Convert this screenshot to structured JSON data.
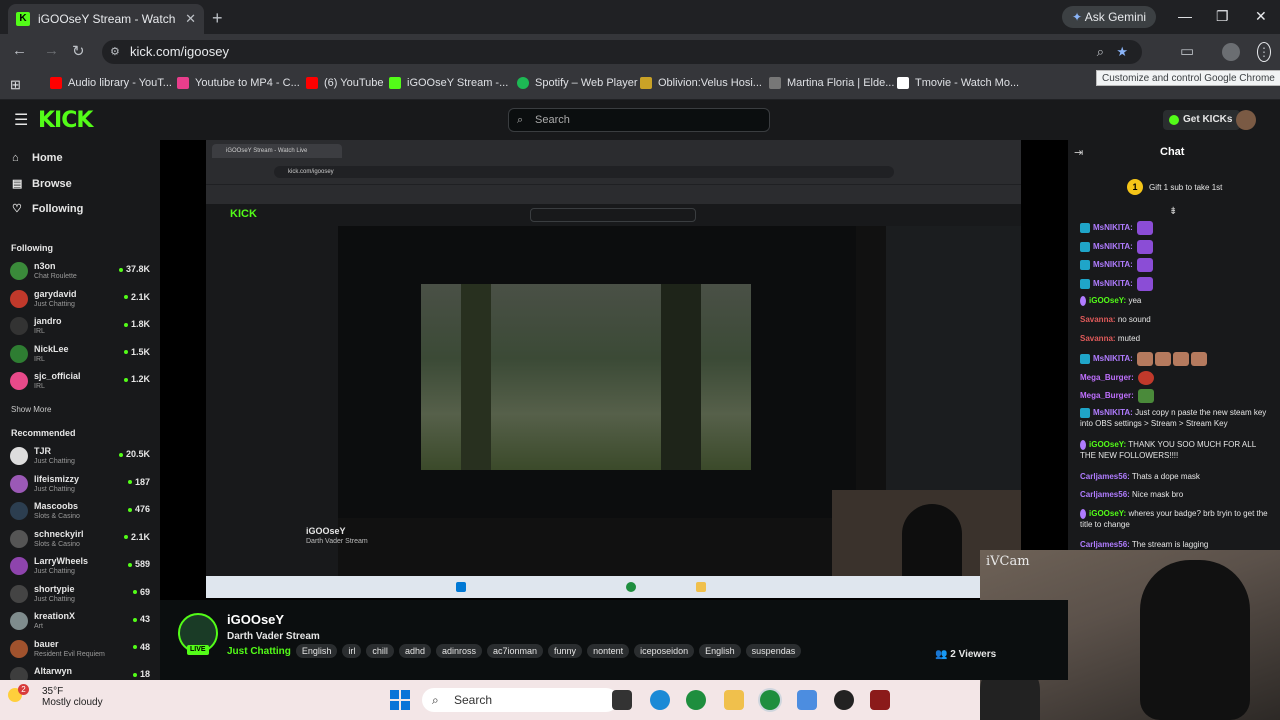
{
  "browser": {
    "tab_title": "iGOOseY Stream - Watch Live o",
    "ask_gemini": "Ask Gemini",
    "url": "kick.com/igoosey",
    "tooltip": "Customize and control Google Chrome",
    "bookmarks": [
      {
        "label": "Audio library - YouT...",
        "color": "#ff0000"
      },
      {
        "label": "Youtube to MP4 - C...",
        "color": "#e83e8c"
      },
      {
        "label": "(6) YouTube",
        "color": "#ff0000"
      },
      {
        "label": "iGOOseY Stream -...",
        "color": "#53fc18"
      },
      {
        "label": "Spotify – Web Player",
        "color": "#1db954"
      },
      {
        "label": "Oblivion:Velus Hosi...",
        "color": "#c9a227"
      },
      {
        "label": "Martina Floria | Elde...",
        "color": "#777777"
      },
      {
        "label": "Tmovie - Watch Mo...",
        "color": "#ffffff"
      }
    ]
  },
  "kick": {
    "logo": "KICK",
    "search_placeholder": "Search",
    "get_kicks": "Get KICKs"
  },
  "sidebar": {
    "nav": [
      {
        "label": "Home",
        "icon": "home-icon"
      },
      {
        "label": "Browse",
        "icon": "browse-icon"
      },
      {
        "label": "Following",
        "icon": "heart-icon"
      }
    ],
    "following_heading": "Following",
    "following": [
      {
        "name": "n3on",
        "sub": "Chat Roulette",
        "count": "37.8K",
        "color": "#3a8a3a"
      },
      {
        "name": "garydavid",
        "sub": "Just Chatting",
        "count": "2.1K",
        "color": "#c0392b"
      },
      {
        "name": "jandro",
        "sub": "IRL",
        "count": "1.8K",
        "color": "#333333"
      },
      {
        "name": "NickLee",
        "sub": "IRL",
        "count": "1.5K",
        "color": "#2e7d32"
      },
      {
        "name": "sjc_official",
        "sub": "IRL",
        "count": "1.2K",
        "color": "#e84a8a"
      }
    ],
    "show_more": "Show More",
    "recommended_heading": "Recommended",
    "recommended": [
      {
        "name": "TJR",
        "sub": "Just Chatting",
        "count": "20.5K",
        "color": "#dddddd"
      },
      {
        "name": "lifeismizzy",
        "sub": "Just Chatting",
        "count": "187",
        "color": "#9b59b6"
      },
      {
        "name": "Mascoobs",
        "sub": "Slots & Casino",
        "count": "476",
        "color": "#2c3e50"
      },
      {
        "name": "schneckyirl",
        "sub": "Slots & Casino",
        "count": "2.1K",
        "color": "#555555"
      },
      {
        "name": "LarryWheels",
        "sub": "Just Chatting",
        "count": "589",
        "color": "#8e44ad"
      },
      {
        "name": "shortypie",
        "sub": "Just Chatting",
        "count": "69",
        "color": "#444444"
      },
      {
        "name": "kreationX",
        "sub": "Art",
        "count": "43",
        "color": "#7f8c8d"
      },
      {
        "name": "bauer",
        "sub": "Resident Evil Requiem",
        "count": "48",
        "color": "#a0522d"
      },
      {
        "name": "Altarwyn",
        "sub": "",
        "count": "18",
        "color": "#3d3d3d"
      }
    ]
  },
  "stream": {
    "streamer": "iGOOseY",
    "title": "Darth Vader Stream",
    "live": "LIVE",
    "category": "Just Chatting",
    "tags": [
      "English",
      "irl",
      "chill",
      "adhd",
      "adinross",
      "ac7ionman",
      "funny",
      "nontent",
      "iceposeidon",
      "English",
      "suspendas"
    ],
    "viewers": "2 Viewers",
    "cam_label": "iVCam"
  },
  "chat": {
    "title": "Chat",
    "gift_text": "Gift 1 sub to take 1st",
    "gift_number": "1",
    "messages": [
      {
        "user": "MsNIKITA:",
        "text": "",
        "color": "#b07cff"
      },
      {
        "user": "MsNIKITA:",
        "text": "",
        "color": "#b07cff"
      },
      {
        "user": "MsNIKITA:",
        "text": "",
        "color": "#b07cff"
      },
      {
        "user": "MsNIKITA:",
        "text": "",
        "color": "#b07cff"
      },
      {
        "user": "iGOOseY:",
        "text": "yea",
        "color": "#53fc18"
      },
      {
        "user": "Savanna:",
        "text": "no sound",
        "color": "#e05a5a"
      },
      {
        "user": "Savanna:",
        "text": "muted",
        "color": "#e05a5a"
      },
      {
        "user": "MsNIKITA:",
        "text": "",
        "color": "#b07cff"
      },
      {
        "user": "Mega_Burger:",
        "text": "",
        "color": "#c070ff"
      },
      {
        "user": "Mega_Burger:",
        "text": "",
        "color": "#c070ff"
      },
      {
        "user": "MsNIKITA:",
        "text": "Just copy n paste the new steam key into OBS settings > Stream > Stream Key",
        "color": "#b07cff"
      },
      {
        "user": "iGOOseY:",
        "text": "THANK YOU SOO MUCH FOR ALL THE NEW FOLLOWERS!!!!",
        "color": "#53fc18"
      },
      {
        "user": "Carljames56:",
        "text": "Thats a dope mask",
        "color": "#b07cff"
      },
      {
        "user": "Carljames56:",
        "text": "Nice mask bro",
        "color": "#b07cff"
      },
      {
        "user": "iGOOseY:",
        "text": "wheres your badge? brb tryin to get the title to change",
        "color": "#53fc18"
      },
      {
        "user": "Carljames56:",
        "text": "The stream is lagging",
        "color": "#b07cff"
      }
    ]
  },
  "taskbar": {
    "weather_temp": "35°F",
    "weather_desc": "Mostly cloudy",
    "notification_count": "2",
    "search_placeholder": "Search"
  },
  "nested": {
    "tab_title": "iGOOseY Stream - Watch Live",
    "url": "kick.com/igoosey",
    "streamer": "iGOOseY",
    "title": "Darth Vader Stream"
  }
}
